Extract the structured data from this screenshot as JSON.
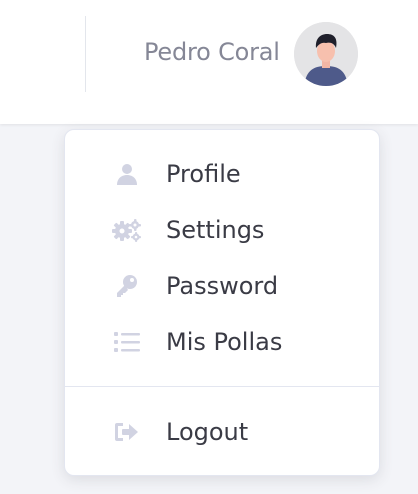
{
  "header": {
    "user_name": "Pedro Coral"
  },
  "menu": {
    "items": [
      {
        "label": "Profile",
        "icon": "user-icon"
      },
      {
        "label": "Settings",
        "icon": "cogs-icon"
      },
      {
        "label": "Password",
        "icon": "key-icon"
      },
      {
        "label": "Mis Pollas",
        "icon": "list-icon"
      }
    ],
    "logout": {
      "label": "Logout",
      "icon": "sign-out-icon"
    }
  },
  "colors": {
    "icon": "#d1d3e2",
    "text": "#3a3b45",
    "muted": "#858796",
    "avatar_shirt": "#4e5a8a"
  }
}
